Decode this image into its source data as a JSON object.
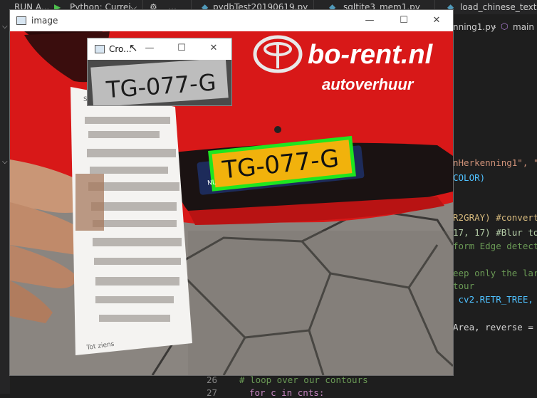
{
  "ide": {
    "run_label": "RUN A...",
    "run_config": "Python: Currei",
    "tabs": [
      "pydbTest20190619.py",
      "sqltite3_mem1.py",
      "load_chinese_text.py"
    ],
    "breadcrumb_file": "nning1.py",
    "breadcrumb_symbol": "main",
    "code_lines": [
      {
        "text": "nHerkenning1\", \""
      },
      {
        "text": "COLOR)"
      },
      {
        "text": "R2GRAY) #convert"
      },
      {
        "text": "17, 17) #Blur to"
      },
      {
        "text": "form Edge detect"
      },
      {
        "text": "eep only the lar"
      },
      {
        "text": "tour"
      },
      {
        "text": " cv2.RETR_TREE, c"
      },
      {
        "text": "Area, reverse = "
      }
    ],
    "bottom_lines": [
      {
        "num": "26",
        "text": "# loop over our contours"
      },
      {
        "num": "27",
        "text": "for c in cnts:"
      }
    ]
  },
  "image_window": {
    "title": "image",
    "plate_text": "TG-077-G",
    "plate_country": "NL",
    "banner_text": "bo-rent.nl",
    "banner_sub": "autoverhuur",
    "receipt_footer": "Tot ziens",
    "receipt_header": "S"
  },
  "crop_window": {
    "title": "Cro...",
    "plate_text": "TG-077-G"
  },
  "colors": {
    "car_red": "#d81818",
    "plate_yellow": "#f1b20c",
    "contour_green": "#1fe61f",
    "ide_bg": "#1e1e1e"
  }
}
